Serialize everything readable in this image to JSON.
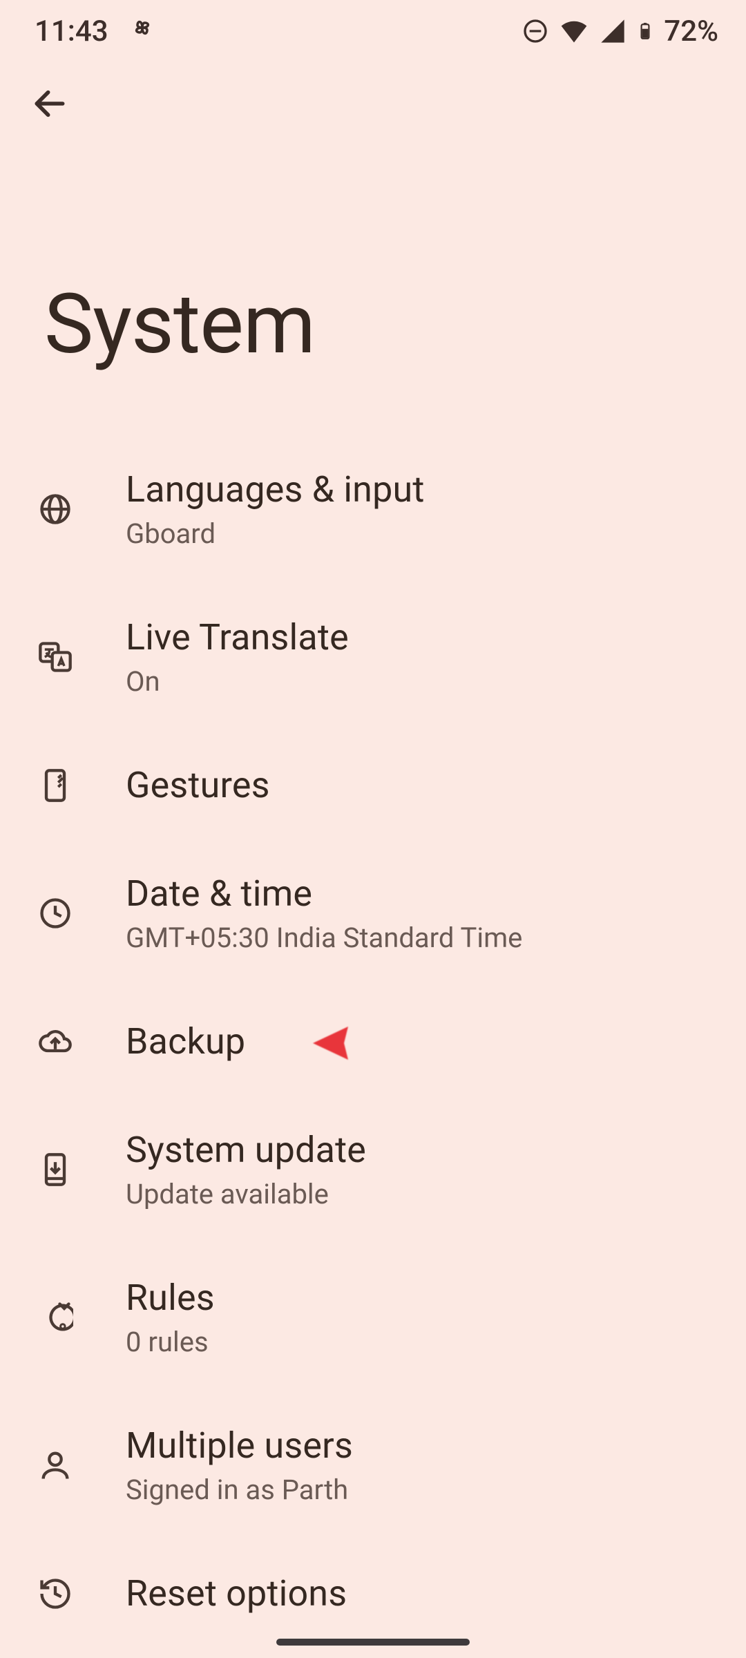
{
  "status": {
    "time": "11:43",
    "battery": "72%"
  },
  "page": {
    "title": "System"
  },
  "items": [
    {
      "title": "Languages & input",
      "sub": "Gboard"
    },
    {
      "title": "Live Translate",
      "sub": "On"
    },
    {
      "title": "Gestures",
      "sub": ""
    },
    {
      "title": "Date & time",
      "sub": "GMT+05:30 India Standard Time"
    },
    {
      "title": "Backup",
      "sub": ""
    },
    {
      "title": "System update",
      "sub": "Update available"
    },
    {
      "title": "Rules",
      "sub": "0 rules"
    },
    {
      "title": "Multiple users",
      "sub": "Signed in as Parth"
    },
    {
      "title": "Reset options",
      "sub": ""
    }
  ]
}
